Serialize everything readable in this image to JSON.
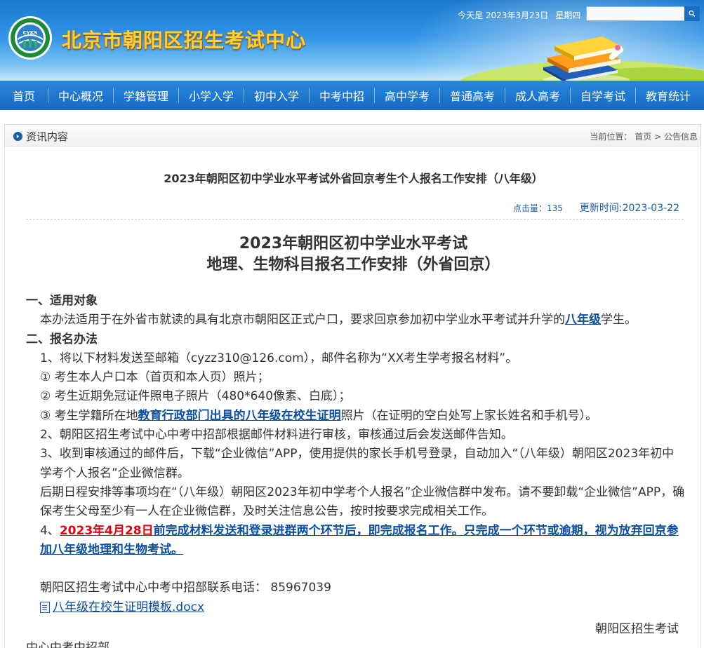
{
  "header": {
    "site_title": "北京市朝阳区招生考试中心",
    "logo_text": "CYKS",
    "date_text": "今天是 2023年3月23日",
    "weekday_text": "星期四",
    "search_placeholder": ""
  },
  "nav": {
    "items": [
      {
        "label": "首页"
      },
      {
        "label": "中心概况"
      },
      {
        "label": "学籍管理"
      },
      {
        "label": "小学入学"
      },
      {
        "label": "初中入学"
      },
      {
        "label": "中考中招"
      },
      {
        "label": "高中学考"
      },
      {
        "label": "普通高考"
      },
      {
        "label": "成人高考"
      },
      {
        "label": "自学考试"
      },
      {
        "label": "教育统计"
      }
    ]
  },
  "crumb": {
    "section_title": "资讯内容",
    "location_label": "当前位置：",
    "home_link": "首页",
    "separator": ">",
    "current": "公告信息"
  },
  "article": {
    "title": "2023年朝阳区初中学业水平考试外省回京考生个人报名工作安排（八年级）",
    "hits_label": "点击量：",
    "hits_value": "135",
    "updated_label": "更新时间:",
    "updated_value": "2023-03-22",
    "doc_title_line1": "2023年朝阳区初中学业水平考试",
    "doc_title_line2": "地理、生物科目报名工作安排（外省回京）",
    "sec1_heading": "一、适用对象",
    "sec1_text_a": "本办法适用于在外省市就读的具有北京市朝阳区正式户口，要求回京参加初中学业水平考试并升学的",
    "sec1_link": "八年级",
    "sec1_text_b": "学生。",
    "sec2_heading": "二、报名办法",
    "item1": "1、将以下材料发送至邮箱（cyzz310@126.com），邮件名称为“XX考生学考报名材料”。",
    "sub1": "① 考生本人户口本（首页和本人页）照片；",
    "sub2": "② 考生近期免冠证件照电子照片（480*640像素、白底）；",
    "sub3_a": "③ 考生学籍所在地",
    "sub3_link": "教育行政部门出具的八年级在校生证明",
    "sub3_b": "照片（在证明的空白处写上家长姓名和手机号）。",
    "item2": "2、朝阳区招生考试中心中考中招部根据邮件材料进行审核，审核通过后会发送邮件告知。",
    "item3": "3、收到审核通过的邮件后，下载“企业微信”APP，使用提供的家长手机号登录，自动加入“（八年级）朝阳区2023年初中学考个人报名”企业微信群。",
    "item3b": "后期日程安排等事项均在“（八年级）朝阳区2023年初中学考个人报名”企业微信群中发布。请不要卸载“企业微信”APP，确保考生父母至少有一人在企业微信群，及时关注信息公告，按时按要求完成相关工作。",
    "item4_prefix": "4、",
    "item4_date": "2023年4月28日",
    "item4_text": "前完成材料发送和登录进群两个环节后，即完成报名工作。只完成一个环节或逾期，视为放弃回京参加八年级地理和生物考试。",
    "contact": "朝阳区招生考试中心中考中招部联系电话： 85967039",
    "attachment": "八年级在校生证明模板.docx",
    "sign1": "朝阳区招生考试",
    "sign2": "中心中考中招部"
  },
  "colors": {
    "nav_bg": "#1769c2",
    "link_blue": "#0b4ea2",
    "highlight_red": "#e60012",
    "title_gold": "#f8d23b"
  }
}
